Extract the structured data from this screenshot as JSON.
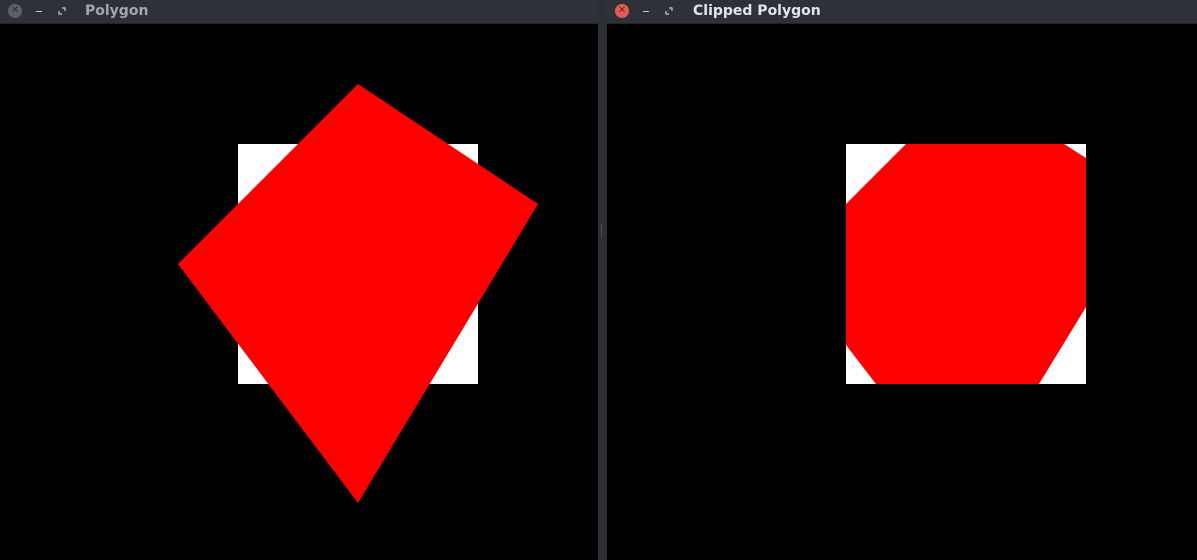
{
  "windows": {
    "left": {
      "title": "Polygon",
      "focused": false
    },
    "right": {
      "title": "Clipped Polygon",
      "focused": true
    }
  },
  "controls": {
    "close_icon": "close-icon",
    "minimize_icon": "minimize-icon",
    "maximize_icon": "maximize-icon"
  },
  "colors": {
    "canvas_background": "#000000",
    "clip_window": "#ffffff",
    "polygon_fill": "#ff0000",
    "titlebar": "#2f3139",
    "active_close": "#e35a56",
    "inactive_close": "#5e6067"
  }
}
